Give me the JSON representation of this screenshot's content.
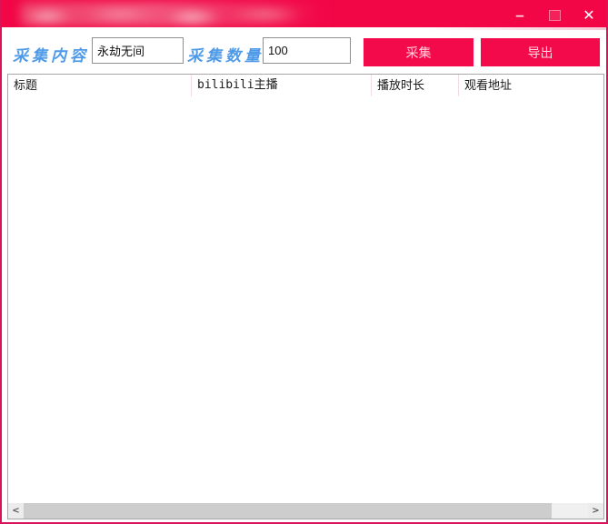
{
  "window": {
    "controls": {
      "minimize": "–",
      "close": "✕"
    }
  },
  "toolbar": {
    "content_label": "采集内容",
    "content_value": "永劫无间",
    "count_label": "采集数量",
    "count_value": "100",
    "collect_button": "采集",
    "export_button": "导出"
  },
  "table": {
    "columns": [
      {
        "label": "标题"
      },
      {
        "label": "bilibili主播"
      },
      {
        "label": "播放时长"
      },
      {
        "label": "观看地址"
      }
    ],
    "rows": []
  },
  "scrollbar": {
    "left_arrow": "<",
    "right_arrow": ">"
  },
  "colors": {
    "titlebar": "#F20646",
    "window_border": "#D8135A",
    "button": "#F20A4B",
    "button_text": "#FFD6DE",
    "label_blue": "#4E9AE8",
    "list_border": "#A9A6A9",
    "header_separator": "#F3DCE3",
    "scrollbar_thumb": "#CDCDCD"
  }
}
